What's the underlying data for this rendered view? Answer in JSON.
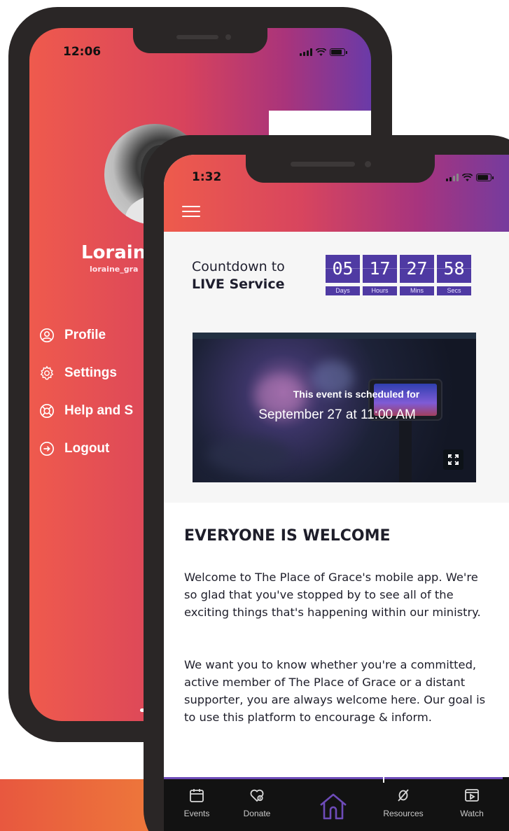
{
  "back_phone": {
    "status_time": "12:06",
    "profile": {
      "name": "Lorain",
      "username": "loraine_gra"
    },
    "menu": [
      {
        "label": "Profile",
        "icon": "user-icon"
      },
      {
        "label": "Settings",
        "icon": "gear-icon"
      },
      {
        "label": "Help and S",
        "icon": "lifebuoy-icon"
      },
      {
        "label": "Logout",
        "icon": "logout-icon"
      }
    ]
  },
  "front_phone": {
    "status_time": "1:32",
    "countdown": {
      "label_line1": "Countdown to",
      "label_line2": "LIVE Service",
      "units": [
        {
          "value": "05",
          "label": "Days"
        },
        {
          "value": "17",
          "label": "Hours"
        },
        {
          "value": "27",
          "label": "Mins"
        },
        {
          "value": "58",
          "label": "Secs"
        }
      ]
    },
    "video": {
      "line1": "This event is scheduled for",
      "line2": "September 27  at 11:00 AM"
    },
    "welcome": {
      "title": "EVERYONE IS WELCOME",
      "paragraph1": "Welcome to The Place of Grace's mobile app.  We're so glad that you've stopped by to see all of the exciting things that's happening within our ministry.",
      "paragraph2": "We want you to know whether you're a committed, active member of The Place of Grace or a distant supporter, you are always welcome here.  Our goal is to use this platform to encourage & inform."
    },
    "tabs": [
      {
        "label": "Events",
        "icon": "calendar-icon"
      },
      {
        "label": "Donate",
        "icon": "donate-icon"
      },
      {
        "label": "",
        "icon": "home-icon",
        "active": true
      },
      {
        "label": "Resources",
        "icon": "resources-icon"
      },
      {
        "label": "Watch",
        "icon": "watch-icon"
      }
    ]
  },
  "colors": {
    "gradient_start": "#ef5a4d",
    "gradient_end": "#5c3fae",
    "countdown_box": "#4f3aa3",
    "active_tab": "#6d4bb8",
    "tabbar": "#121212"
  }
}
